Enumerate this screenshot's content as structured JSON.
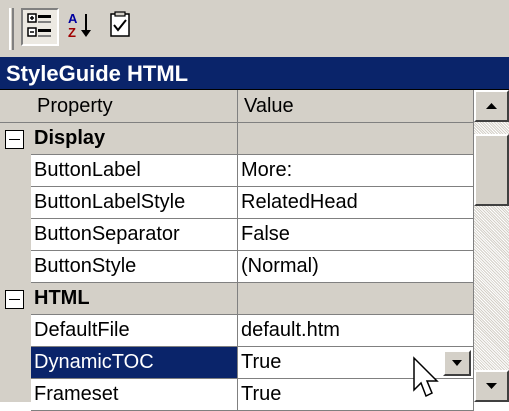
{
  "toolbar": {
    "buttons": [
      {
        "icon": "categorized-icon",
        "pressed": true
      },
      {
        "icon": "sort-alphabetical-icon",
        "pressed": false
      },
      {
        "icon": "property-pages-icon",
        "pressed": false
      }
    ]
  },
  "title": "StyleGuide HTML",
  "columns": {
    "property": "Property",
    "value": "Value"
  },
  "rows": [
    {
      "type": "category",
      "name": "Display"
    },
    {
      "type": "prop",
      "name": "ButtonLabel",
      "value": "More:"
    },
    {
      "type": "prop",
      "name": "ButtonLabelStyle",
      "value": "RelatedHead"
    },
    {
      "type": "prop",
      "name": "ButtonSeparator",
      "value": "False"
    },
    {
      "type": "prop",
      "name": "ButtonStyle",
      "value": "(Normal)"
    },
    {
      "type": "category",
      "name": "HTML"
    },
    {
      "type": "prop",
      "name": "DefaultFile",
      "value": "default.htm"
    },
    {
      "type": "prop",
      "name": "DynamicTOC",
      "value": "True",
      "selected": true,
      "dropdown": true
    },
    {
      "type": "prop",
      "name": "Frameset",
      "value": "True"
    }
  ],
  "colors": {
    "title_bg": "#0a246a",
    "selection_bg": "#0a246a",
    "face": "#d4d0c8"
  }
}
